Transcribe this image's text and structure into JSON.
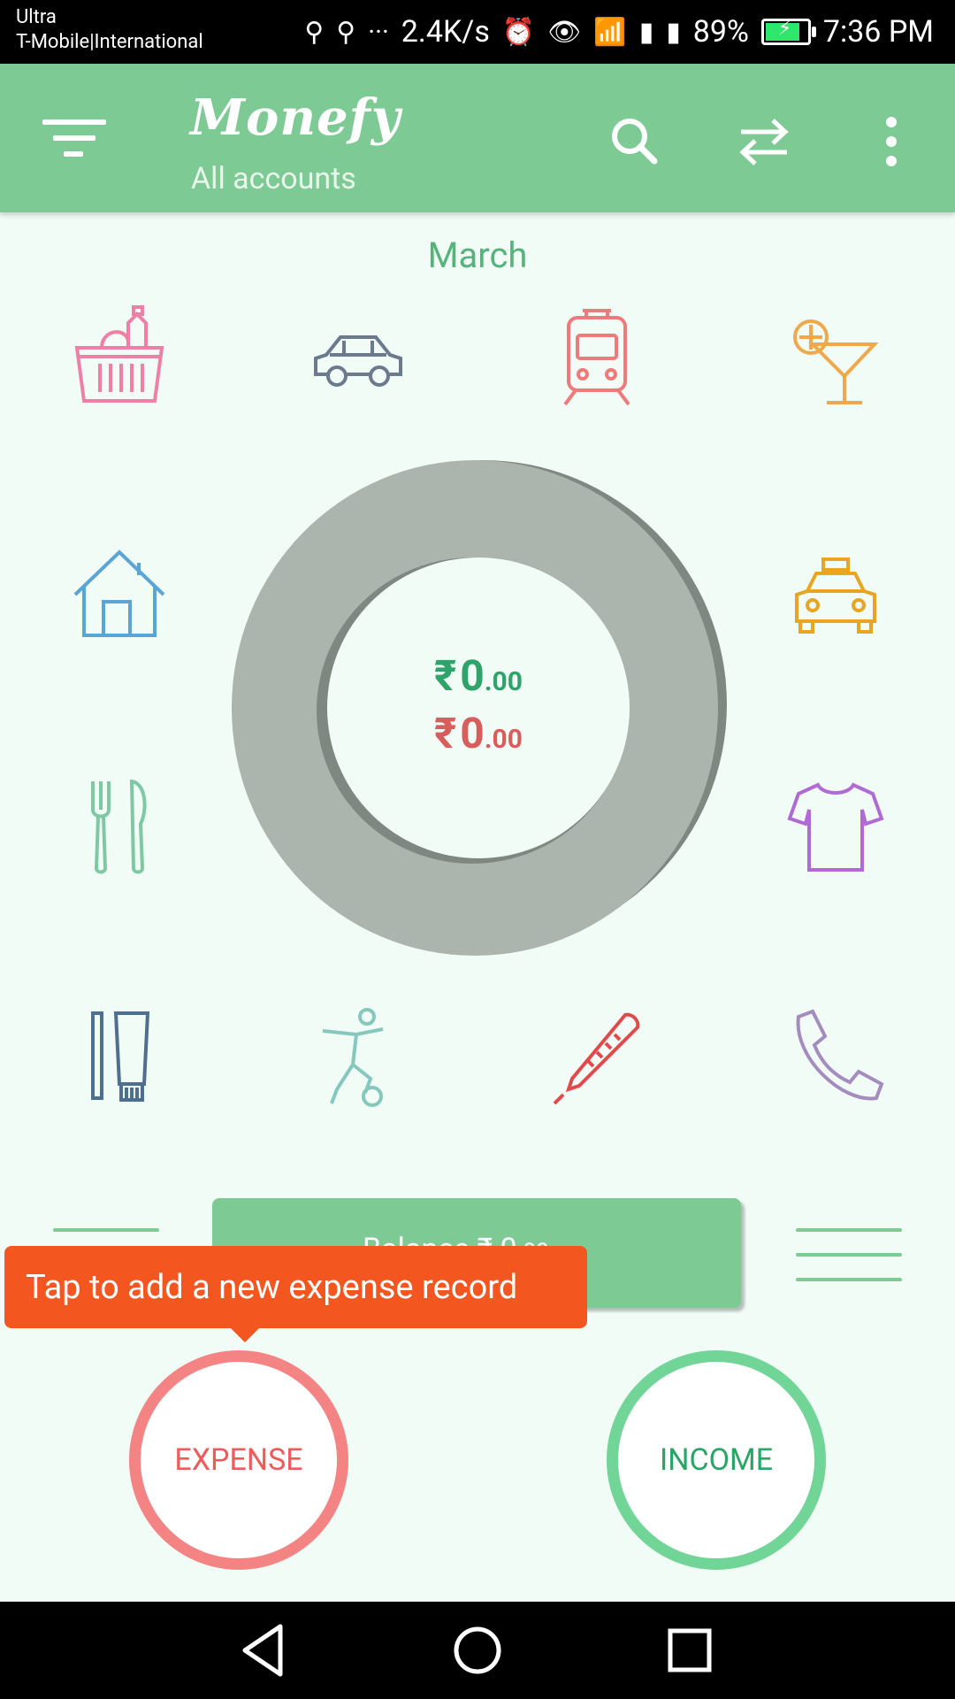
{
  "status_bar": {
    "carrier_line1": "Ultra",
    "carrier_line2": "T-Mobile|International",
    "net_speed": "2.4K/s",
    "battery": "89%",
    "time": "7:36 PM"
  },
  "app_bar": {
    "title": "Monefy",
    "subtitle": "All accounts"
  },
  "month": "March",
  "categories": [
    {
      "name": "groceries",
      "color": "#ee7fa6"
    },
    {
      "name": "car",
      "color": "#6c7a8e"
    },
    {
      "name": "train",
      "color": "#ee7b7b"
    },
    {
      "name": "cocktail",
      "color": "#f0a84a"
    },
    {
      "name": "house",
      "color": "#5ba4d6"
    },
    {
      "name": "taxi",
      "color": "#e8a521"
    },
    {
      "name": "eating-out",
      "color": "#7fc8a4"
    },
    {
      "name": "clothes",
      "color": "#b06ad6"
    },
    {
      "name": "toiletry",
      "color": "#4e7090"
    },
    {
      "name": "sports",
      "color": "#85c8be"
    },
    {
      "name": "health",
      "color": "#e24a4a"
    },
    {
      "name": "phone",
      "color": "#a58cbe"
    }
  ],
  "totals": {
    "income_symbol": "₹",
    "income_int": "0",
    "income_dec": ".00",
    "expense_symbol": "₹",
    "expense_int": "0",
    "expense_dec": ".00",
    "income_color": "#2ea36a",
    "expense_color": "#d85e5e"
  },
  "balance": {
    "label": "Balance ₹ 0",
    "decimals": ".00"
  },
  "tooltip": "Tap to add a new expense record",
  "buttons": {
    "expense": "EXPENSE",
    "income": "INCOME"
  }
}
